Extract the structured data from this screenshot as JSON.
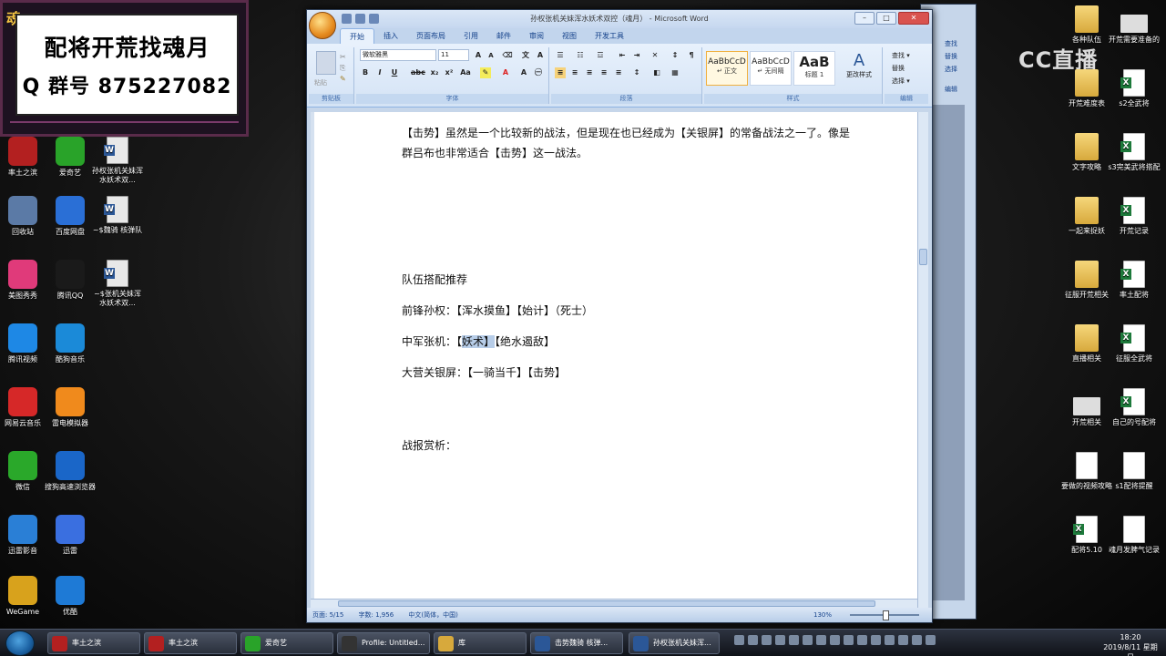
{
  "banner": {
    "line1": "配将开荒找魂月",
    "line2": "Q 群号 875227082"
  },
  "watermark": "CC直播",
  "desktop_left": [
    {
      "label": "率土之滨",
      "color": "#b32020"
    },
    {
      "label": "爱奇艺",
      "color": "#29a329"
    },
    {
      "label": "孙权张机关妹浑水妖术双...",
      "kind": "word"
    },
    {
      "label": "回收站",
      "color": "#5b7aa6"
    },
    {
      "label": "百度网盘",
      "color": "#2a6fd6"
    },
    {
      "label": "~$魏骑 核弹队",
      "kind": "word"
    },
    {
      "label": "美图秀秀",
      "color": "#e03a7a"
    },
    {
      "label": "腾讯QQ",
      "color": "#1a1a1a"
    },
    {
      "label": "~$张机关妹浑水妖术双...",
      "kind": "word"
    },
    {
      "label": "腾讯视频",
      "color": "#1e88e5"
    },
    {
      "label": "酷狗音乐",
      "color": "#1b8ad8"
    },
    {
      "label": "网易云音乐",
      "color": "#d62828"
    },
    {
      "label": "雷电模拟器",
      "color": "#f08a1c"
    },
    {
      "label": "微信",
      "color": "#2aa82a"
    },
    {
      "label": "搜狗高速浏览器",
      "color": "#1a66c8"
    },
    {
      "label": "迅雷影音",
      "color": "#2a7fd6"
    },
    {
      "label": "迅雷",
      "color": "#3a6fe0"
    },
    {
      "label": "WeGame",
      "color": "#d8a21c"
    },
    {
      "label": "优酷",
      "color": "#1e7ad6"
    }
  ],
  "desktop_right": [
    {
      "label": "各种队伍",
      "kind": "folder"
    },
    {
      "label": "开荒需要准备的",
      "kind": "thumb"
    },
    {
      "label": "开荒难度表",
      "kind": "folder"
    },
    {
      "label": "s2全武将",
      "kind": "xls"
    },
    {
      "label": "文字攻略",
      "kind": "folder"
    },
    {
      "label": "s3完美武将搭配",
      "kind": "xls"
    },
    {
      "label": "一起来捉妖",
      "kind": "folder"
    },
    {
      "label": "开荒记录",
      "kind": "xls"
    },
    {
      "label": "征服开荒相关",
      "kind": "folder"
    },
    {
      "label": "率土配将",
      "kind": "xls"
    },
    {
      "label": "直播相关",
      "kind": "folder"
    },
    {
      "label": "征服全武将",
      "kind": "xls"
    },
    {
      "label": "开荒相关",
      "kind": "thumb"
    },
    {
      "label": "自己的号配将",
      "kind": "xls"
    },
    {
      "label": "要做的视频攻略",
      "kind": "doc"
    },
    {
      "label": "s1配将提醒",
      "kind": "doc"
    },
    {
      "label": "配将5.10",
      "kind": "xls"
    },
    {
      "label": "魂月发脾气记录",
      "kind": "doc"
    }
  ],
  "word": {
    "title": "孙权张机关妹浑水妖术双控（魂月） - Microsoft Word",
    "tabs": [
      "开始",
      "插入",
      "页面布局",
      "引用",
      "邮件",
      "审阅",
      "视图",
      "开发工具"
    ],
    "font_name": "微软雅黑",
    "font_size": "11",
    "groups": {
      "clipboard": "剪贴板",
      "font": "字体",
      "paragraph": "段落",
      "styles": "样式",
      "editing": "编辑"
    },
    "paste_label": "粘贴",
    "styles": [
      {
        "sample": "AaBbCcD",
        "name": "↵ 正文"
      },
      {
        "sample": "AaBbCcD",
        "name": "↵ 无间隔"
      },
      {
        "sample": "AaB",
        "name": "标题 1"
      }
    ],
    "change_styles": "更改样式",
    "editing": [
      "查找 ▾",
      "替换",
      "选择 ▾"
    ],
    "doc": {
      "p1": "【击势】虽然是一个比较新的战法，但是现在也已经成为【关银屏】的常备战法之一了。像是群吕布也非常适合【击势】这一战法。",
      "p2": "队伍搭配推荐",
      "p3": "前锋孙权：【浑水摸鱼】【始计】（死士）",
      "p4_a": "中军张机：【",
      "p4_sel": "妖术】",
      "p4_b": "【绝水遏敌】",
      "p5": "大营关银屏：【一骑当千】【击势】",
      "p6": "战报赏析："
    },
    "status": {
      "page": "页面: 5/15",
      "words": "字数: 1,956",
      "lang": "中文(简体，中国)",
      "zoom": "130%"
    }
  },
  "bgwin_labels": [
    "查找",
    "替换",
    "选择",
    "编辑"
  ],
  "taskbar": {
    "buttons": [
      {
        "label": "率土之滨",
        "color": "#b32020"
      },
      {
        "label": "率土之滨",
        "color": "#b32020"
      },
      {
        "label": "爱奇艺",
        "color": "#29a329"
      },
      {
        "label": "Profile: Untitled...",
        "color": "#333"
      },
      {
        "label": "库",
        "color": "#d7a93c"
      },
      {
        "label": "击势魏骑 核弹...",
        "color": "#2b5797"
      },
      {
        "label": "孙权张机关妹浑...",
        "color": "#2b5797"
      }
    ],
    "time": "18:20",
    "date": "2019/8/11 星期日"
  }
}
